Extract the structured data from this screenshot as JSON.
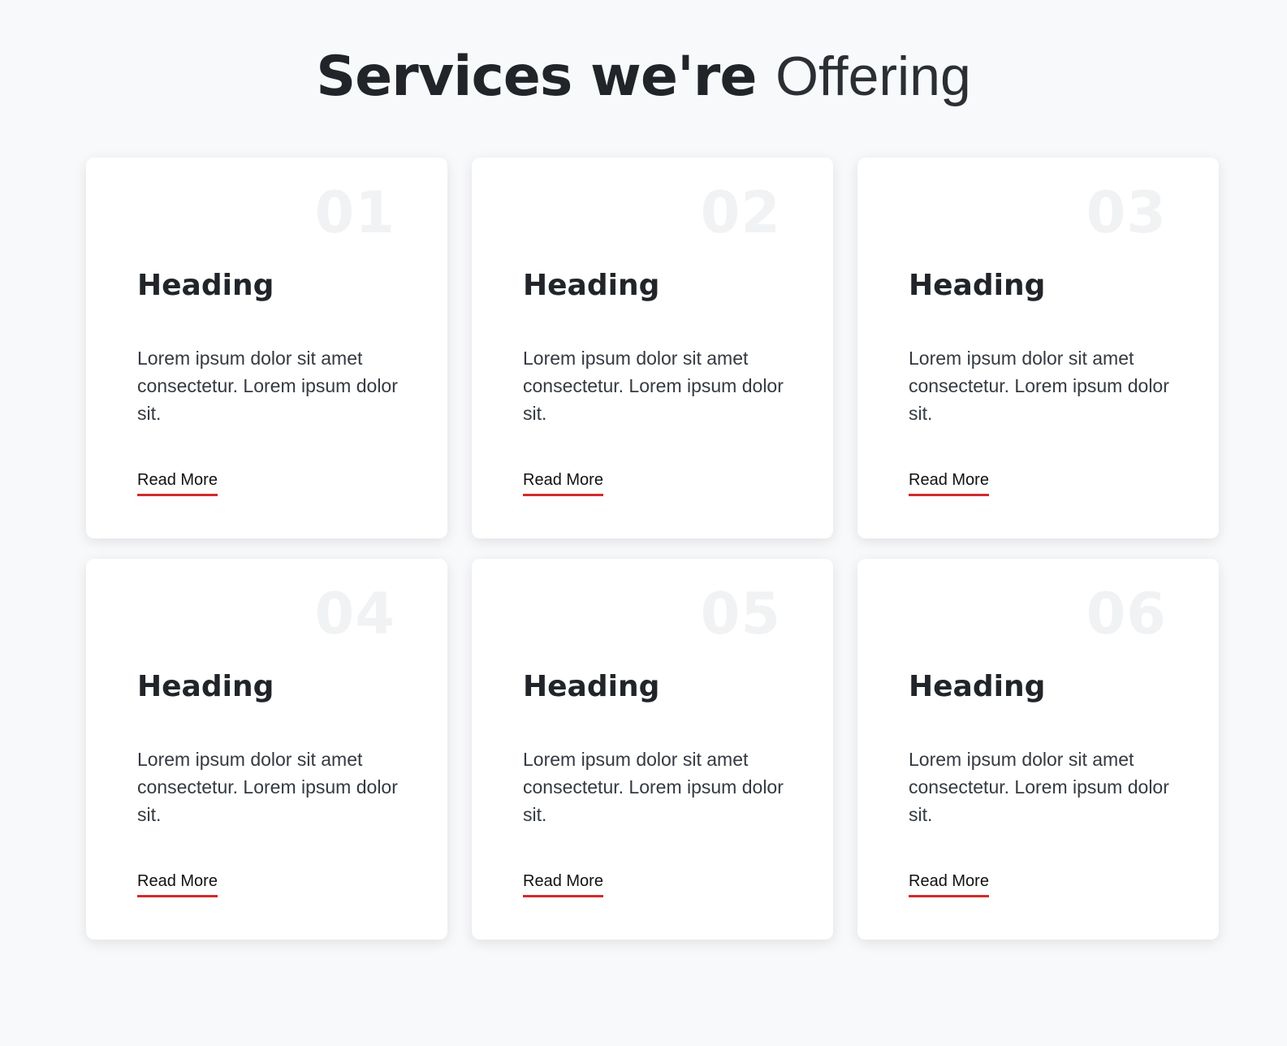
{
  "header": {
    "title_bold": "Services we're",
    "title_light": "Offering"
  },
  "cards": [
    {
      "number": "01",
      "heading": "Heading",
      "text": "Lorem ipsum dolor sit amet consectetur. Lorem ipsum dolor sit.",
      "link_label": "Read More"
    },
    {
      "number": "02",
      "heading": "Heading",
      "text": "Lorem ipsum dolor sit amet consectetur. Lorem ipsum dolor sit.",
      "link_label": "Read More"
    },
    {
      "number": "03",
      "heading": "Heading",
      "text": "Lorem ipsum dolor sit amet consectetur. Lorem ipsum dolor sit.",
      "link_label": "Read More"
    },
    {
      "number": "04",
      "heading": "Heading",
      "text": "Lorem ipsum dolor sit amet consectetur. Lorem ipsum dolor sit.",
      "link_label": "Read More"
    },
    {
      "number": "05",
      "heading": "Heading",
      "text": "Lorem ipsum dolor sit amet consectetur. Lorem ipsum dolor sit.",
      "link_label": "Read More"
    },
    {
      "number": "06",
      "heading": "Heading",
      "text": "Lorem ipsum dolor sit amet consectetur. Lorem ipsum dolor sit.",
      "link_label": "Read More"
    }
  ],
  "colors": {
    "accent": "#d32a2a",
    "background": "#f8f9fb",
    "card": "#ffffff",
    "number_watermark": "#f1f2f3"
  }
}
